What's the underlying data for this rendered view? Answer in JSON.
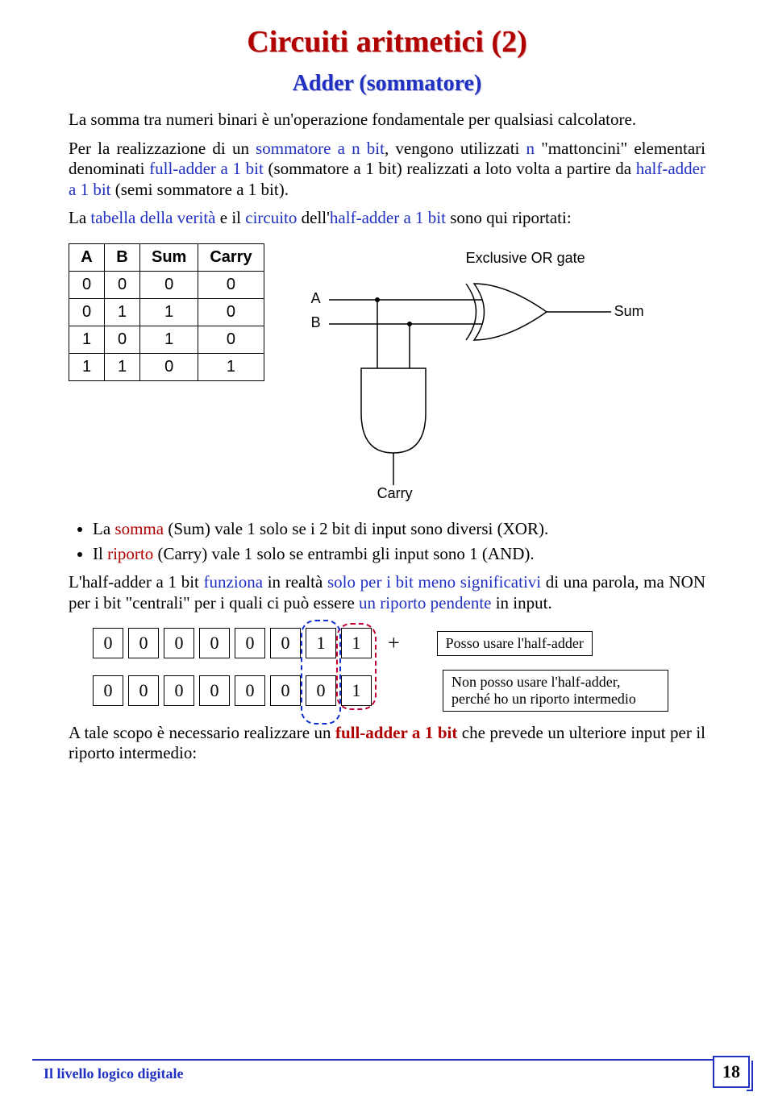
{
  "title": "Circuiti aritmetici (2)",
  "subtitle": "Adder (sommatore)",
  "p1_a": "La somma tra numeri binari è un'operazione fondamentale per qualsiasi calcolatore.",
  "p2_pre": "Per la realizzazione di un ",
  "p2_b1": "sommatore a n bit",
  "p2_mid1": ", vengono utilizzati ",
  "p2_n": "n",
  "p2_mid2": " \"mattoncini\" elementari denominati ",
  "p2_b2": "full-adder a 1 bit",
  "p2_mid3": " (sommatore a 1 bit) realizzati a loto volta a partire da ",
  "p2_b3": "half-adder a 1 bit",
  "p2_tail": " (semi sommatore a 1 bit).",
  "p3_a": "La ",
  "p3_b1": "tabella della verità",
  "p3_mid1": " e il ",
  "p3_b2": "circuito",
  "p3_mid2": " dell'",
  "p3_b3": "half-adder a 1 bit",
  "p3_tail": " sono qui riportati:",
  "truth": {
    "headers": [
      "A",
      "B",
      "Sum",
      "Carry"
    ],
    "rows": [
      [
        "0",
        "0",
        "0",
        "0"
      ],
      [
        "0",
        "1",
        "1",
        "0"
      ],
      [
        "1",
        "0",
        "1",
        "0"
      ],
      [
        "1",
        "1",
        "0",
        "1"
      ]
    ]
  },
  "circuit": {
    "xor": "Exclusive OR gate",
    "A": "A",
    "B": "B",
    "sum": "Sum",
    "carry": "Carry"
  },
  "bul1_a": "La ",
  "bul1_b": "somma",
  "bul1_c": " (Sum) vale 1 solo se i 2 bit di input sono diversi (XOR).",
  "bul2_a": "Il ",
  "bul2_b": "riporto",
  "bul2_c": " (Carry) vale 1 solo se entrambi gli input sono 1 (AND).",
  "p4_a": "L'half-adder a 1 bit ",
  "p4_b1": "funziona",
  "p4_mid1": " in realtà ",
  "p4_b2": "solo per i bit meno significativi",
  "p4_mid2": " di una parola, ma NON per i bit \"centrali\" per i quali ci può essere ",
  "p4_b3": "un riporto pendente",
  "p4_tail": " in input.",
  "bits_top": [
    "0",
    "0",
    "0",
    "0",
    "0",
    "0",
    "1",
    "1"
  ],
  "bits_bot": [
    "0",
    "0",
    "0",
    "0",
    "0",
    "0",
    "0",
    "1"
  ],
  "plus": "+",
  "ann1": "Posso usare l'half-adder",
  "ann2": "Non posso usare l'half-adder, perché ho un riporto intermedio",
  "p5_a": "A tale scopo è necessario realizzare un ",
  "p5_b": "full-adder a 1 bit",
  "p5_c": " che prevede un ulteriore input per il riporto intermedio:",
  "footer_left": "Il livello logico digitale",
  "footer_page": "18"
}
